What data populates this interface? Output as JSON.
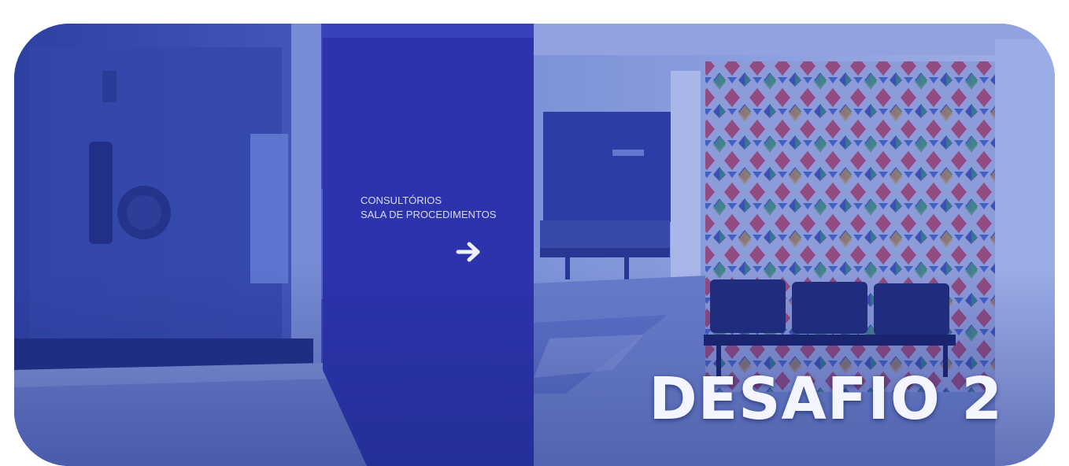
{
  "card": {
    "title": "DESAFIO 2",
    "sign_lines": [
      "CONSULTÓRIOS",
      "SALA DE PROCEDIMENTOS"
    ]
  },
  "icons": {
    "sign_arrow": "arrow-right-icon"
  },
  "colors": {
    "tint": "#3a4fb0",
    "title_text": "#f4f6ff",
    "background": "#ffffff"
  }
}
